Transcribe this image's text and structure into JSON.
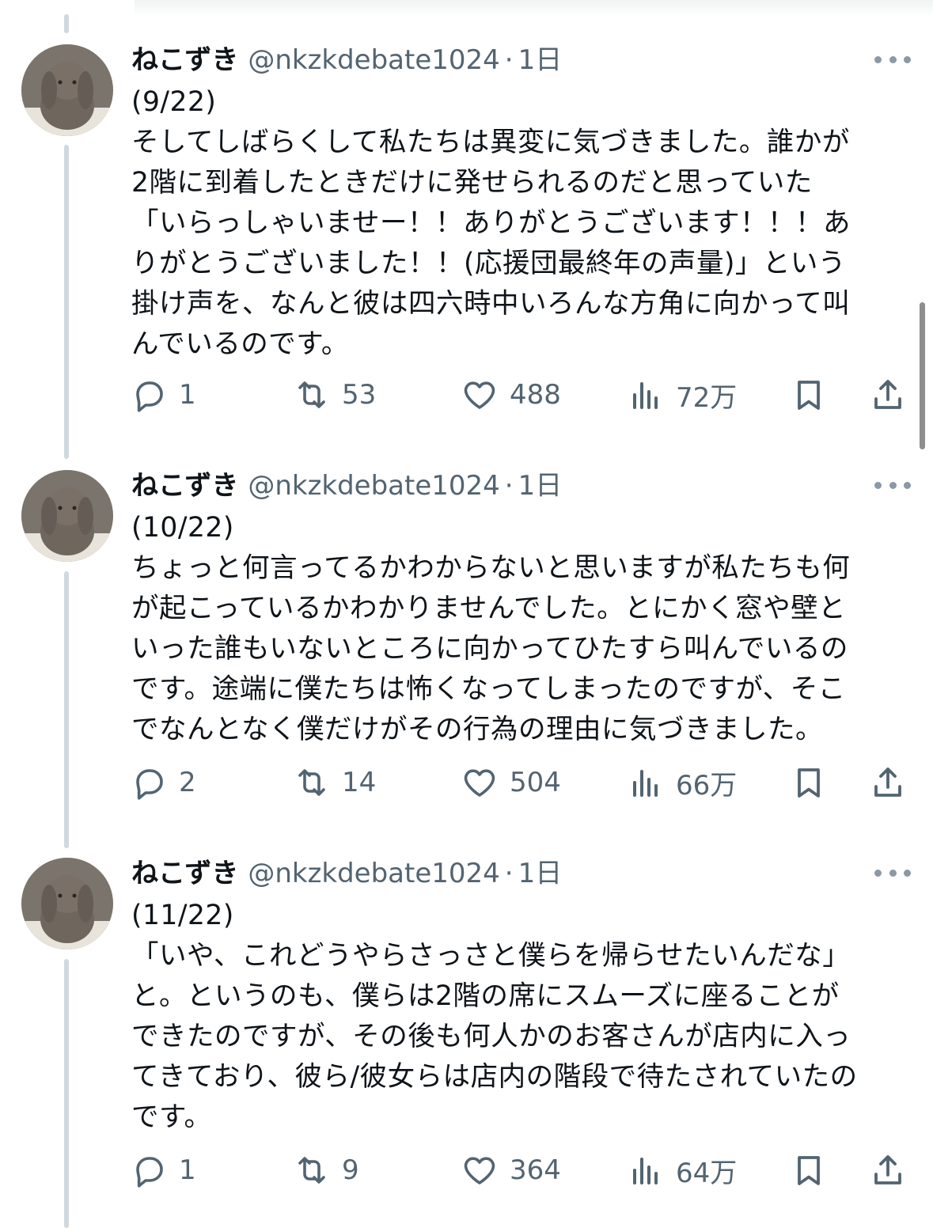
{
  "tweets": [
    {
      "name": "ねこずき",
      "handle": "@nkzkdebate1024",
      "dot": "·",
      "time": "1日",
      "lines": [
        "(9/22)",
        "そしてしばらくして私たちは異変に気づきました。誰かが",
        "2階に到着したときだけに発せられるのだと思っていた",
        "「いらっしゃいませー！！ありがとうございます！！！あ",
        "りがとうございました！！(応援団最終年の声量)」という",
        "掛け声を、なんと彼は四六時中いろんな方角に向かって叫",
        "んでいるのです。"
      ],
      "replies": "1",
      "reposts": "53",
      "likes": "488",
      "views": "72万"
    },
    {
      "name": "ねこずき",
      "handle": "@nkzkdebate1024",
      "dot": "·",
      "time": "1日",
      "lines": [
        "(10/22)",
        "ちょっと何言ってるかわからないと思いますが私たちも何",
        "が起こっているかわかりませんでした。とにかく窓や壁と",
        "いった誰もいないところに向かってひたすら叫んでいるの",
        "です。途端に僕たちは怖くなってしまったのですが、そこ",
        "でなんとなく僕だけがその行為の理由に気づきました。"
      ],
      "replies": "2",
      "reposts": "14",
      "likes": "504",
      "views": "66万"
    },
    {
      "name": "ねこずき",
      "handle": "@nkzkdebate1024",
      "dot": "·",
      "time": "1日",
      "lines": [
        "(11/22)",
        "「いや、これどうやらさっさと僕らを帰らせたいんだな」",
        "と。というのも、僕らは2階の席にスムーズに座ることが",
        "できたのですが、その後も何人かのお客さんが店内に入っ",
        "てきており、彼ら/彼女らは店内の階段で待たされていたの",
        "です。"
      ],
      "replies": "1",
      "reposts": "9",
      "likes": "364",
      "views": "64万"
    }
  ],
  "icons": {
    "reply": "reply-icon",
    "repost": "repost-icon",
    "like": "heart-icon",
    "views": "views-icon",
    "bookmark": "bookmark-icon",
    "share": "share-icon",
    "more": "more-icon"
  },
  "colors": {
    "text": "#0f1419",
    "secondary": "#536471",
    "thread_line": "#cfd9de"
  }
}
